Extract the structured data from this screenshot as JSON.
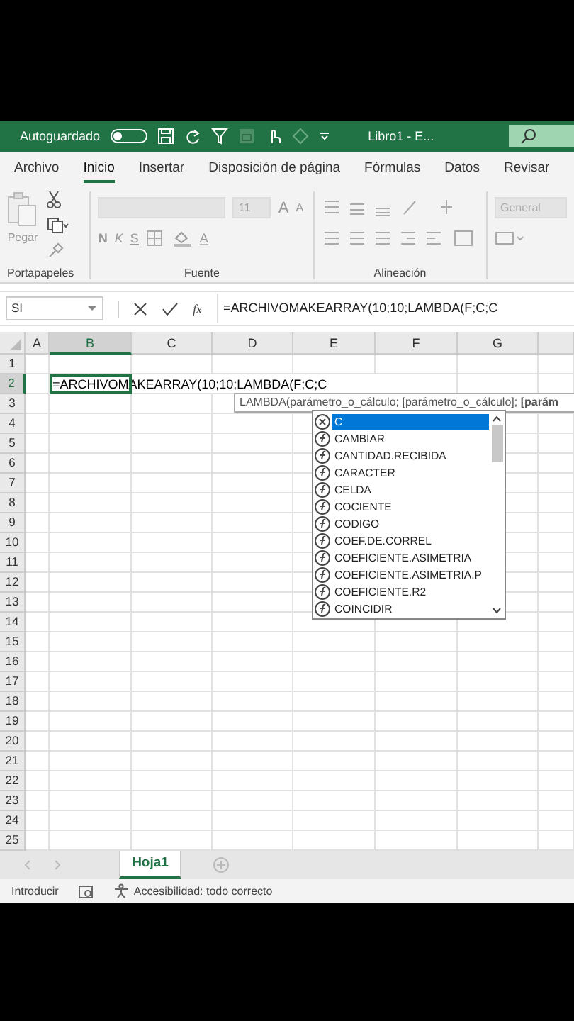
{
  "title_bar": {
    "autosave_label": "Autoguardado",
    "autosave_on": false,
    "document_title": "Libro1 - E..."
  },
  "ribbon_tabs": [
    {
      "label": "Archivo",
      "selected": false
    },
    {
      "label": "Inicio",
      "selected": true
    },
    {
      "label": "Insertar",
      "selected": false
    },
    {
      "label": "Disposición de página",
      "selected": false
    },
    {
      "label": "Fórmulas",
      "selected": false
    },
    {
      "label": "Datos",
      "selected": false
    },
    {
      "label": "Revisar",
      "selected": false
    }
  ],
  "ribbon": {
    "paste_label": "Pegar",
    "font_size": "11",
    "grow_letter": "A",
    "shrink_letter": "A",
    "bold": "N",
    "italic": "K",
    "underline": "S",
    "font_color_letter": "A",
    "number_format": "General",
    "groups": [
      "Portapapeles",
      "Fuente",
      "Alineación"
    ]
  },
  "formula_bar": {
    "name_box": "SI",
    "function_label": "fx",
    "formula": "=ARCHIVOMAKEARRAY(10;10;LAMBDA(F;C;C"
  },
  "columns": [
    {
      "label": "A",
      "selected": false
    },
    {
      "label": "B",
      "selected": true
    },
    {
      "label": "C",
      "selected": false
    },
    {
      "label": "D",
      "selected": false
    },
    {
      "label": "E",
      "selected": false
    },
    {
      "label": "F",
      "selected": false
    },
    {
      "label": "G",
      "selected": false
    }
  ],
  "rows": [
    {
      "label": "1",
      "selected": false
    },
    {
      "label": "2",
      "selected": true
    },
    {
      "label": "3",
      "selected": false
    },
    {
      "label": "4",
      "selected": false
    },
    {
      "label": "5",
      "selected": false
    },
    {
      "label": "6",
      "selected": false
    },
    {
      "label": "7",
      "selected": false
    },
    {
      "label": "8",
      "selected": false
    },
    {
      "label": "9",
      "selected": false
    },
    {
      "label": "10",
      "selected": false
    },
    {
      "label": "11",
      "selected": false
    },
    {
      "label": "12",
      "selected": false
    },
    {
      "label": "13",
      "selected": false
    },
    {
      "label": "14",
      "selected": false
    },
    {
      "label": "15",
      "selected": false
    },
    {
      "label": "16",
      "selected": false
    },
    {
      "label": "17",
      "selected": false
    },
    {
      "label": "18",
      "selected": false
    },
    {
      "label": "19",
      "selected": false
    },
    {
      "label": "20",
      "selected": false
    },
    {
      "label": "21",
      "selected": false
    },
    {
      "label": "22",
      "selected": false
    },
    {
      "label": "23",
      "selected": false
    },
    {
      "label": "24",
      "selected": false
    },
    {
      "label": "25",
      "selected": false
    }
  ],
  "active_cell": {
    "text": "=ARCHIVOMAKEARRAY(10;10;LAMBDA(F;C;C"
  },
  "tooltip": "LAMBDA(parámetro_o_cálculo; [parámetro_o_cálculo]; **[parám**",
  "autocomplete": [
    {
      "kind": "variable",
      "label": "C",
      "selected": true
    },
    {
      "kind": "function",
      "label": "CAMBIAR",
      "selected": false
    },
    {
      "kind": "function",
      "label": "CANTIDAD.RECIBIDA",
      "selected": false
    },
    {
      "kind": "function",
      "label": "CARACTER",
      "selected": false
    },
    {
      "kind": "function",
      "label": "CELDA",
      "selected": false
    },
    {
      "kind": "function",
      "label": "COCIENTE",
      "selected": false
    },
    {
      "kind": "function",
      "label": "CODIGO",
      "selected": false
    },
    {
      "kind": "function",
      "label": "COEF.DE.CORREL",
      "selected": false
    },
    {
      "kind": "function",
      "label": "COEFICIENTE.ASIMETRIA",
      "selected": false
    },
    {
      "kind": "function",
      "label": "COEFICIENTE.ASIMETRIA.P",
      "selected": false
    },
    {
      "kind": "function",
      "label": "COEFICIENTE.R2",
      "selected": false
    },
    {
      "kind": "function",
      "label": "COINCIDIR",
      "selected": false
    }
  ],
  "sheet_tabs": [
    {
      "label": "Hoja1",
      "selected": true
    }
  ],
  "status_bar": {
    "mode": "Introducir",
    "accessibility": "Accesibilidad: todo correcto"
  }
}
